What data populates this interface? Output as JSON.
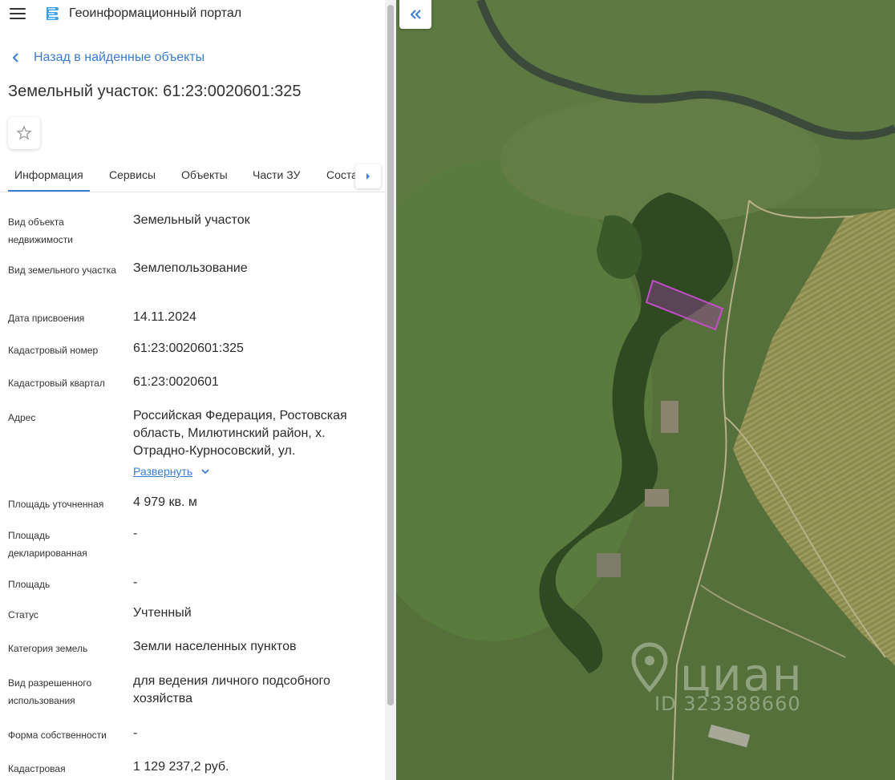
{
  "header": {
    "title": "Геоинформационный портал"
  },
  "nav": {
    "back_label": "Назад в найденные объекты"
  },
  "page": {
    "title": "Земельный участок: 61:23:0020601:325"
  },
  "tabs": [
    {
      "label": "Информация"
    },
    {
      "label": "Сервисы"
    },
    {
      "label": "Объекты"
    },
    {
      "label": "Части ЗУ"
    },
    {
      "label": "Соста"
    }
  ],
  "info": {
    "rows": [
      {
        "label": "Вид объекта недвижимости",
        "value": "Земельный участок"
      },
      {
        "label": "Вид земельного участка",
        "value": "Землепользование"
      },
      {
        "label": "Дата присвоения",
        "value": "14.11.2024"
      },
      {
        "label": "Кадастровый номер",
        "value": "61:23:0020601:325"
      },
      {
        "label": "Кадастровый квартал",
        "value": "61:23:0020601"
      },
      {
        "label": "Адрес",
        "value": "Российская Федерация, Ростовская область, Милютинский район, х. Отрадно-Курносовский, ул."
      },
      {
        "label": "Площадь уточненная",
        "value": "4 979 кв. м"
      },
      {
        "label": "Площадь декларированная",
        "value": "-"
      },
      {
        "label": "Площадь",
        "value": "-"
      },
      {
        "label": "Статус",
        "value": "Учтенный"
      },
      {
        "label": "Категория земель",
        "value": "Земли населенных пунктов"
      },
      {
        "label": "Вид разрешенного использования",
        "value": "для ведения личного подсобного хозяйства"
      },
      {
        "label": "Форма собственности",
        "value": "-"
      },
      {
        "label": "Кадастровая",
        "value": "1 129 237,2 руб."
      }
    ],
    "expand_label": "Развернуть"
  },
  "map": {
    "watermark_brand": "циан",
    "watermark_id": "ID 323388660",
    "parcel_color": "#c44dc9"
  },
  "colors": {
    "accent": "#3a7bd5"
  }
}
